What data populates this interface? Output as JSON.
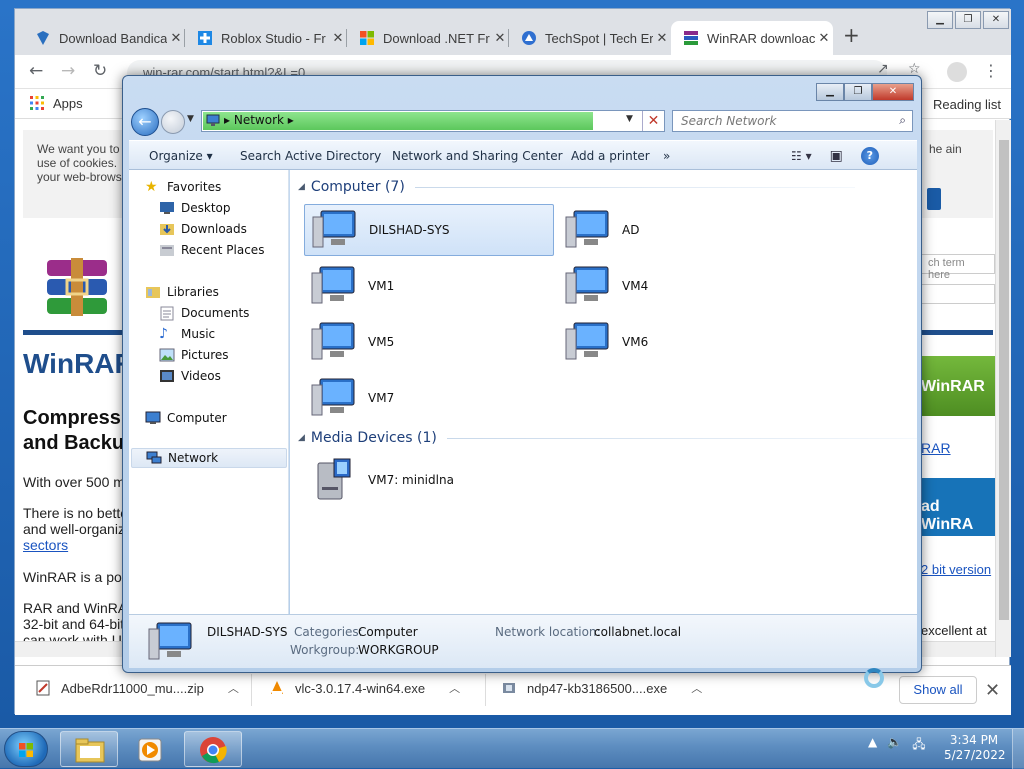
{
  "browser": {
    "tabs": [
      {
        "title": "Download Bandica",
        "icon": "bandicam-icon"
      },
      {
        "title": "Roblox Studio - Fr",
        "icon": "roblox-icon"
      },
      {
        "title": "Download .NET Fr",
        "icon": "windows-icon"
      },
      {
        "title": "TechSpot | Tech Er",
        "icon": "techspot-icon"
      },
      {
        "title": "WinRAR downloac",
        "icon": "winrar-icon"
      }
    ],
    "url": "win-rar.com/start.html?&L=0",
    "bookmarks": {
      "apps": "Apps",
      "reading_list": "Reading list"
    },
    "page": {
      "cookie_left": "We want you to use of cookies. your web-brows",
      "cookie_right": "he ain",
      "heading": "WinRAR",
      "subheading": "Compress and Backu",
      "p1": "With over 500 m",
      "p2": "There is no bette and well-organiz",
      "p2_link": "sectors",
      "p3": "WinRAR is a po",
      "p4": "RAR and WinRA 32-bit and 64-bit can work with U",
      "search_placeholder": "ch term here",
      "green_btn": "WinRAR",
      "rar_link": "RAR",
      "blue_btn": "ad WinRA",
      "bit_link": "2 bit version",
      "excellent": "excellent at"
    },
    "downloads": [
      {
        "name": "AdbeRdr11000_mu....zip",
        "icon": "zip-file-icon"
      },
      {
        "name": "vlc-3.0.17.4-win64.exe",
        "icon": "vlc-icon"
      },
      {
        "name": "ndp47-kb3186500....exe",
        "icon": "installer-icon"
      }
    ],
    "show_all": "Show all"
  },
  "explorer": {
    "address": "Network",
    "search_placeholder": "Search Network",
    "commands": [
      "Organize",
      "Search Active Directory",
      "Network and Sharing Center",
      "Add a printer",
      "»"
    ],
    "nav": {
      "favorites": "Favorites",
      "desktop": "Desktop",
      "downloads": "Downloads",
      "recent": "Recent Places",
      "libraries": "Libraries",
      "documents": "Documents",
      "music": "Music",
      "pictures": "Pictures",
      "videos": "Videos",
      "computer": "Computer",
      "network": "Network"
    },
    "group_computer": "Computer (7)",
    "group_media": "Media Devices (1)",
    "computers": [
      "DILSHAD-SYS",
      "AD",
      "VM1",
      "VM4",
      "VM5",
      "VM6",
      "VM7"
    ],
    "media": [
      "VM7: minidlna"
    ],
    "details": {
      "name": "DILSHAD-SYS",
      "categories_label": "Categories:",
      "categories": "Computer",
      "workgroup_label": "Workgroup:",
      "workgroup": "WORKGROUP",
      "netloc_label": "Network location:",
      "netloc": "collabnet.local"
    }
  },
  "taskbar": {
    "time": "3:34 PM",
    "date": "5/27/2022"
  }
}
